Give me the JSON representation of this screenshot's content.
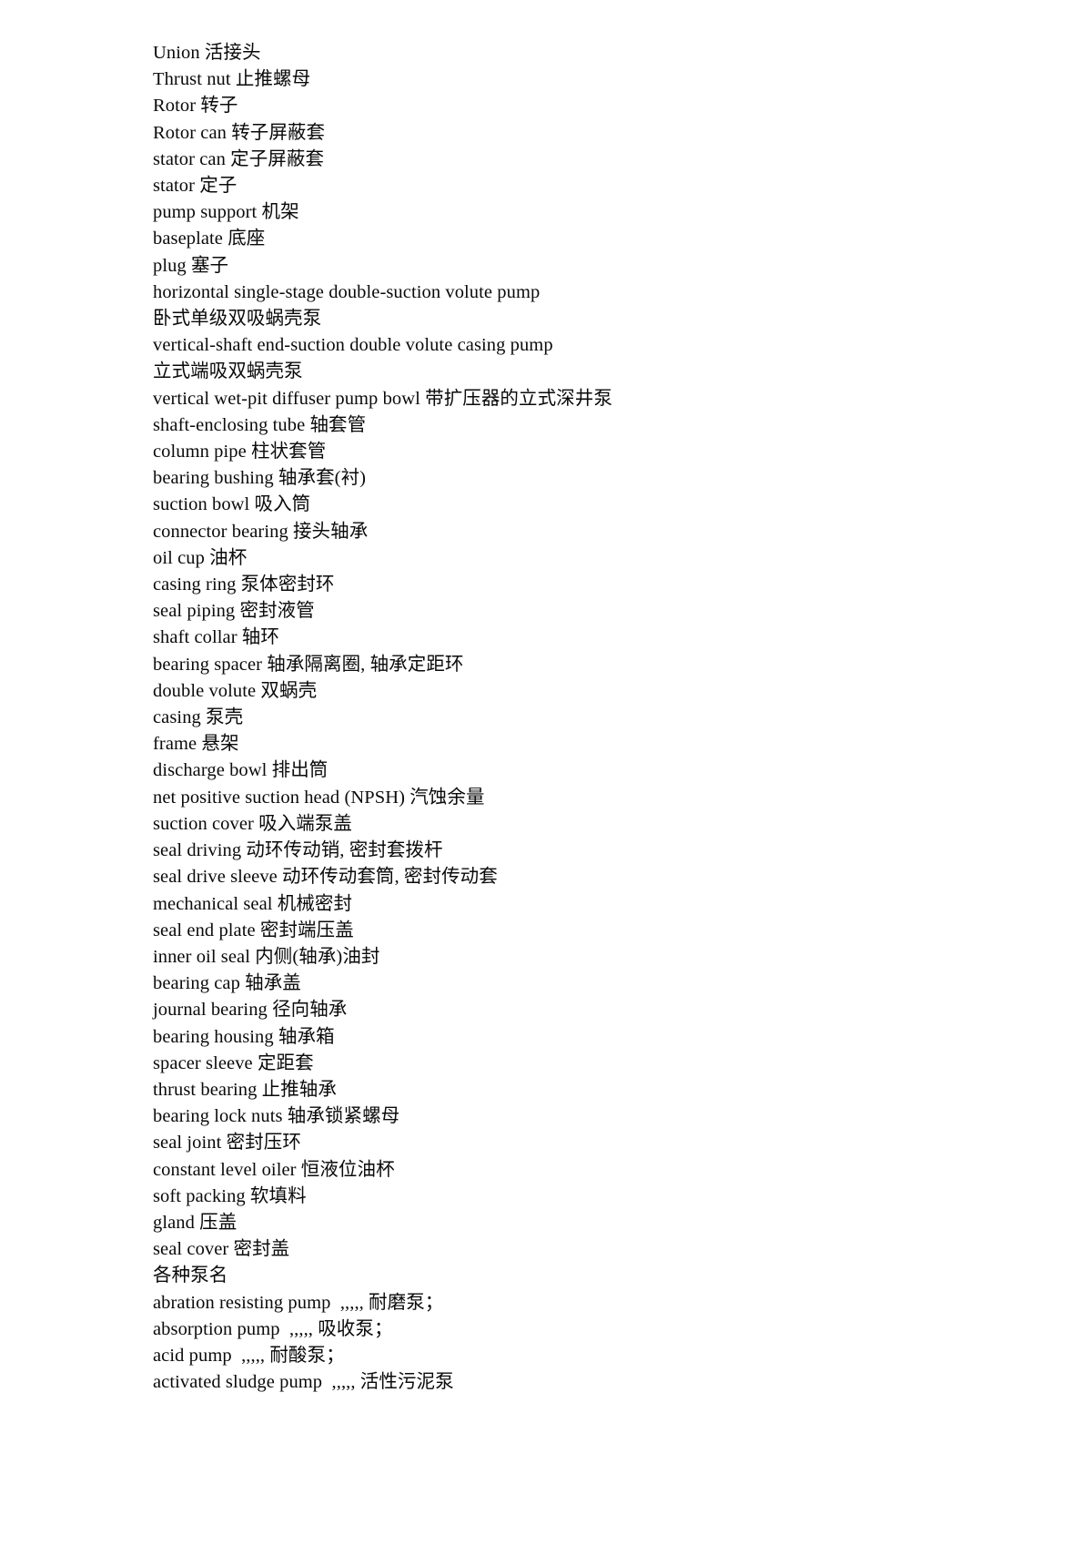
{
  "document": {
    "type": "glossary",
    "language": "en-zh",
    "section_heading": "各种泵名",
    "lines": [
      "Union 活接头",
      "Thrust nut 止推螺母",
      "Rotor 转子",
      "Rotor can 转子屏蔽套",
      "stator can 定子屏蔽套",
      "stator 定子",
      "pump support 机架",
      "baseplate 底座",
      "plug 塞子",
      "horizontal single-stage double-suction volute pump",
      "卧式单级双吸蜗壳泵",
      "vertical-shaft end-suction double volute casing pump",
      "立式端吸双蜗壳泵",
      "vertical wet-pit diffuser pump bowl 带扩压器的立式深井泵",
      "shaft-enclosing tube 轴套管",
      "column pipe 柱状套管",
      "bearing bushing 轴承套(衬)",
      "suction bowl 吸入筒",
      "connector bearing 接头轴承",
      "oil cup 油杯",
      "casing ring 泵体密封环",
      "seal piping 密封液管",
      "shaft collar 轴环",
      "bearing spacer 轴承隔离圈, 轴承定距环",
      "double volute 双蜗壳",
      "casing 泵壳",
      "frame 悬架",
      "discharge bowl 排出筒",
      "net positive suction head (NPSH) 汽蚀余量",
      "suction cover 吸入端泵盖",
      "seal driving 动环传动销, 密封套拨杆",
      "seal drive sleeve 动环传动套筒, 密封传动套",
      "mechanical seal 机械密封",
      "seal end plate 密封端压盖",
      "inner oil seal 内侧(轴承)油封",
      "bearing cap 轴承盖",
      "journal bearing 径向轴承",
      "bearing housing 轴承箱",
      "spacer sleeve 定距套",
      "thrust bearing 止推轴承",
      "bearing lock nuts 轴承锁紧螺母",
      "seal joint 密封压环",
      "constant level oiler 恒液位油杯",
      "soft packing 软填料",
      "gland 压盖",
      "seal cover 密封盖",
      "各种泵名",
      "abration resisting pump  ,,,,, 耐磨泵；",
      "absorption pump  ,,,,, 吸收泵；",
      "acid pump  ,,,,, 耐酸泵；",
      "activated sludge pump  ,,,,, 活性污泥泵"
    ]
  }
}
